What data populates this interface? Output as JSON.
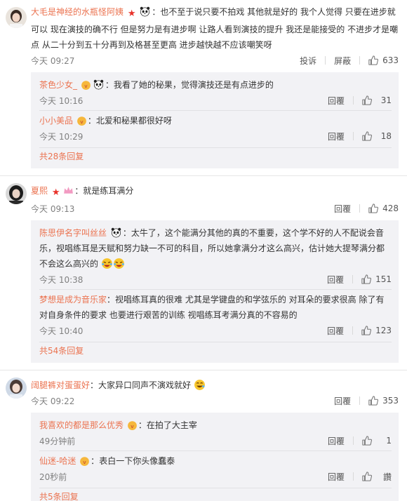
{
  "labels": {
    "reply": "回覆",
    "report": "投诉",
    "block": "屏蔽"
  },
  "comments": [
    {
      "user": "大毛是神经的水瓶怪阿姨",
      "text": "也不至于说只要不拍戏 其他就是好的 我个人觉得 只要在进步就可以 现在演技的确不行 但是努力是有进步啊 让路人看到演技的提升 我还是能接受的 不进步才是嘲点 从二十分到五十分再到及格甚至更高 进步越快越不应该嘲笑呀",
      "time": "今天 09:27",
      "likes": "633",
      "replies": [
        {
          "user": "茶色少女_",
          "text": "我看了她的秘果，觉得演技还是有点进步的",
          "time": "今天 10:16",
          "likes": "31"
        },
        {
          "user": "小小美品",
          "text": "北爱和秘果都很好呀",
          "time": "今天 10:29",
          "likes": "18"
        }
      ],
      "more": "共28条回复"
    },
    {
      "user": "夏熙",
      "text": "就是练耳满分",
      "time": "今天 09:13",
      "likes": "428",
      "replies": [
        {
          "user": "陈思伊名字叫丝丝",
          "text": "太牛了，这个能满分其他的真的不重要，这个学不好的人不配说会音乐，视唱练耳是天赋和努力缺一不可的科目，所以她拿满分才这么高兴，估计她大提琴满分都不会这么高兴的",
          "time": "今天 10:38",
          "likes": "151"
        },
        {
          "user": "梦想是成为音乐家",
          "text": "视唱练耳真的很难 尤其是学键盘的和学弦乐的 对耳朵的要求很高 除了有对自身条件的要求 也要进行艰苦的训练 视唱练耳考满分真的不容易的",
          "time": "今天 10:40",
          "likes": "123"
        }
      ],
      "more": "共54条回复"
    },
    {
      "user": "阔腿裤对蛋蛋好",
      "text": "大家异口同声不演戏就好",
      "time": "今天 09:22",
      "likes": "353",
      "replies": [
        {
          "user": "我喜欢的都是那么优秀",
          "text": "在拍了大主宰",
          "time": "49分钟前",
          "likes": "1"
        },
        {
          "user": "仙迷-哈迷",
          "text": "表白一下你头像蠢泰",
          "time": "20秒前",
          "likes": "讚"
        }
      ],
      "more": "共5条回复"
    }
  ]
}
